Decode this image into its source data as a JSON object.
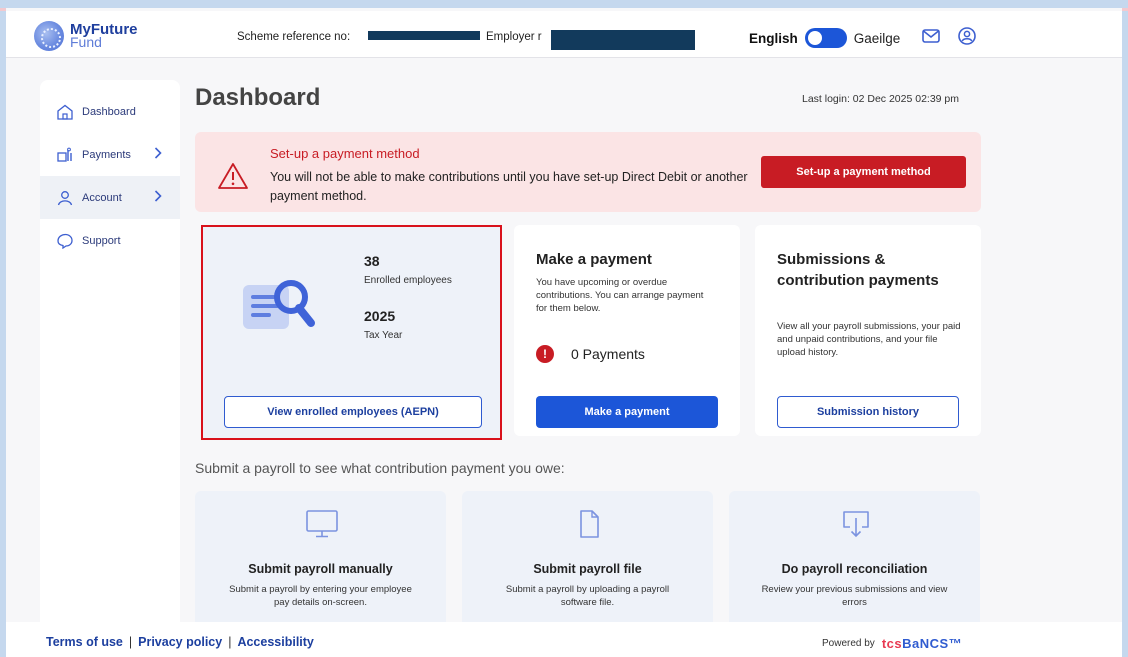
{
  "header": {
    "logo_line1": "MyFuture",
    "logo_line2": "Fund",
    "scheme_label": "Scheme reference no:",
    "employer_label": "Employer r",
    "lang_english": "English",
    "lang_irish": "Gaeilge"
  },
  "sidebar": {
    "items": [
      {
        "label": "Dashboard"
      },
      {
        "label": "Payments"
      },
      {
        "label": "Account"
      },
      {
        "label": "Support"
      }
    ]
  },
  "page": {
    "title": "Dashboard",
    "last_login": "Last login: 02 Dec 2025 02:39 pm"
  },
  "alert": {
    "title": "Set-up a payment method",
    "body": "You will not be able to make contributions until you have set-up Direct Debit or another payment method.",
    "button": "Set-up a payment method"
  },
  "enrolled": {
    "count": "38",
    "count_label": "Enrolled employees",
    "year": "2025",
    "year_label": "Tax Year",
    "button": "View enrolled employees (AEPN)"
  },
  "make_payment": {
    "title": "Make a payment",
    "desc": "You have upcoming or overdue contributions. You can arrange payment for them below.",
    "badge": "!",
    "payments": "0 Payments",
    "button": "Make a payment"
  },
  "submissions": {
    "title": "Submissions & contribution payments",
    "desc": "View all your payroll submissions, your paid and unpaid contributions, and your file upload history.",
    "button": "Submission history"
  },
  "payroll": {
    "heading": "Submit a payroll to see what contribution payment you owe:",
    "cards": [
      {
        "title": "Submit payroll manually",
        "desc": "Submit a payroll by entering your employee pay details on-screen.",
        "icon": "monitor-icon"
      },
      {
        "title": "Submit payroll file",
        "desc": "Submit a payroll by uploading a payroll software file.",
        "icon": "file-icon"
      },
      {
        "title": "Do payroll reconciliation",
        "desc": "Review your previous submissions and view errors",
        "icon": "download-icon"
      }
    ]
  },
  "footer": {
    "terms": "Terms of use",
    "privacy": "Privacy policy",
    "accessibility": "Accessibility",
    "sep": "|",
    "powered_by": "Powered by",
    "brand_a": "tcs",
    "brand_b": "BaNCS™"
  },
  "colors": {
    "brand_blue": "#1c56d8",
    "alert_red": "#c81c24",
    "highlight_red": "#d9111b"
  }
}
